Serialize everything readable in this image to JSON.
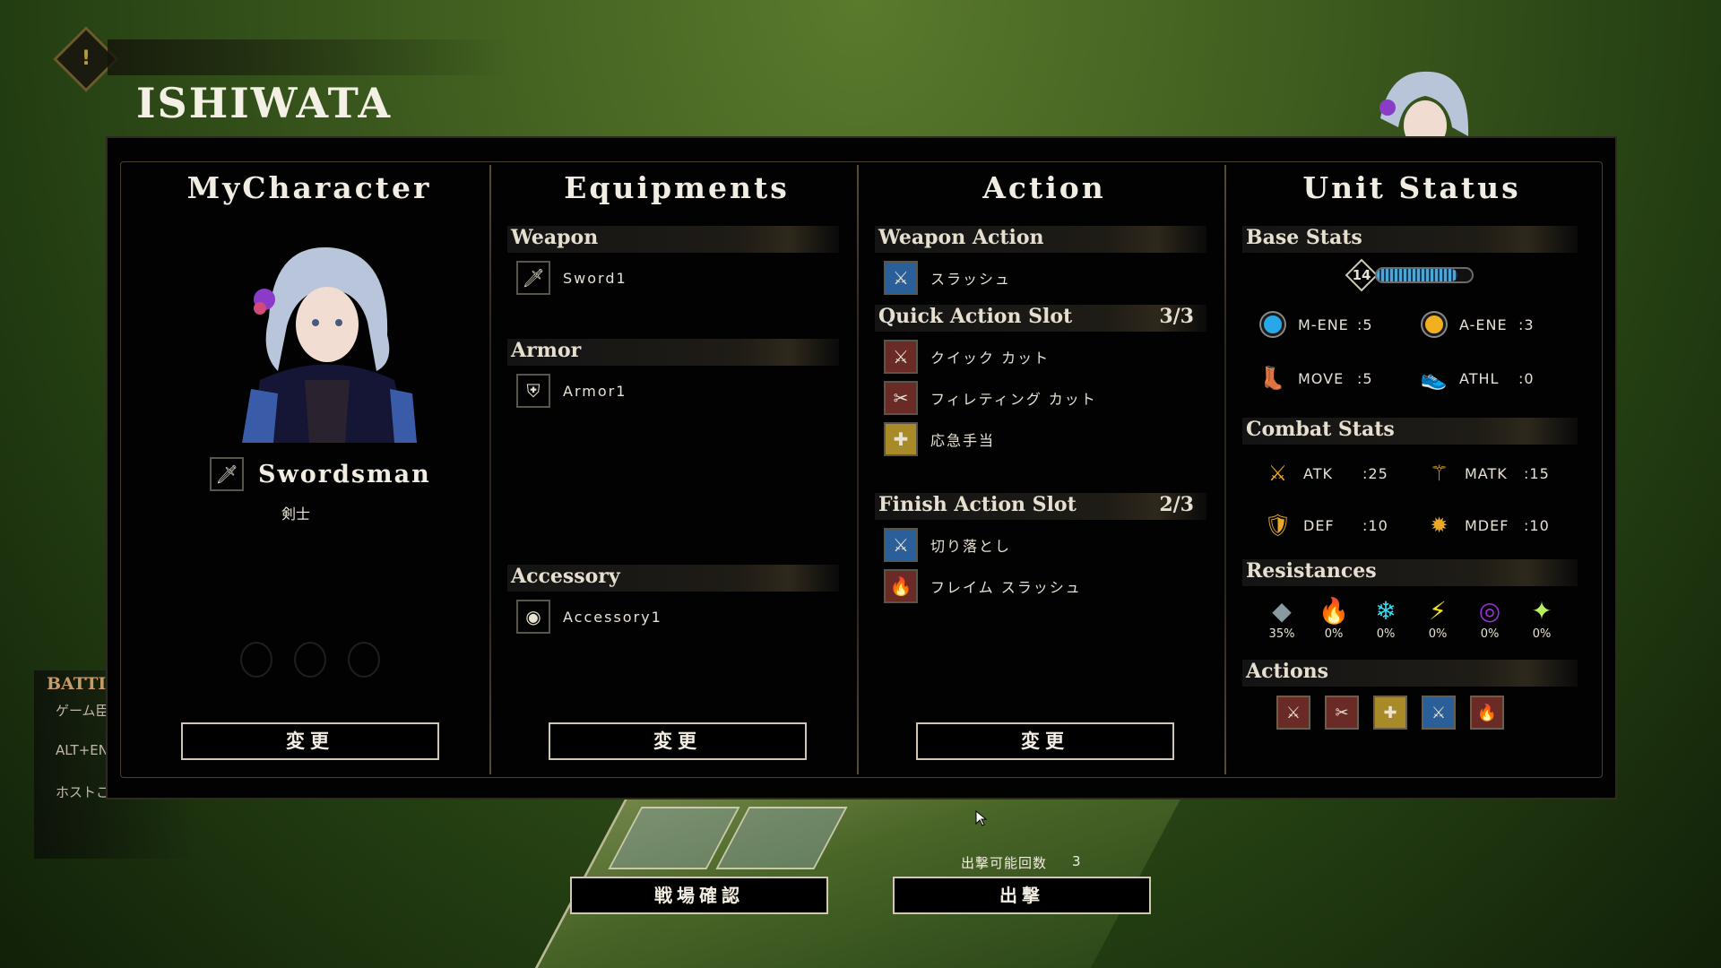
{
  "character": {
    "name": "ISHIWATA",
    "class_name": "Swordsman",
    "class_jp": "剣士"
  },
  "columns": {
    "mycharacter": "MyCharacter",
    "equipments": "Equipments",
    "action": "Action",
    "unit_status": "Unit Status"
  },
  "equipments": {
    "weapon_label": "Weapon",
    "weapon_item": "Sword1",
    "armor_label": "Armor",
    "armor_item": "Armor1",
    "accessory_label": "Accessory",
    "accessory_item": "Accessory1"
  },
  "action": {
    "weapon_action_label": "Weapon Action",
    "weapon_action": "スラッシュ",
    "quick_label": "Quick Action Slot",
    "quick_count": "3/3",
    "quick_items": [
      "クイック カット",
      "フィレティング カット",
      "応急手当"
    ],
    "finish_label": "Finish Action Slot",
    "finish_count": "2/3",
    "finish_items": [
      "切り落とし",
      "フレイム スラッシュ"
    ]
  },
  "status": {
    "base_label": "Base Stats",
    "level": "14",
    "level_fill": 0.85,
    "m_ene_label": "M-ENE",
    "m_ene": ":5",
    "a_ene_label": "A-ENE",
    "a_ene": ":3",
    "move_label": "MOVE",
    "move": ":5",
    "athl_label": "ATHL",
    "athl": ":0",
    "combat_label": "Combat Stats",
    "atk_label": "ATK",
    "atk": ":25",
    "matk_label": "MATK",
    "matk": ":15",
    "def_label": "DEF",
    "def": ":10",
    "mdef_label": "MDEF",
    "mdef": ":10",
    "res_label": "Resistances",
    "resistances": [
      "35%",
      "0%",
      "0%",
      "0%",
      "0%",
      "0%"
    ],
    "actions_label": "Actions"
  },
  "buttons": {
    "change": "変更",
    "battlefield": "戦場確認",
    "sortie": "出撃"
  },
  "sortie_info": {
    "label": "出撃可能回数",
    "count": "3"
  },
  "side_menu": {
    "title": "BATTI",
    "items": [
      "ゲーム臣",
      "ALT+EN",
      "ホストこ"
    ]
  },
  "top_badge": "!",
  "colors": {
    "accent_gold": "#b89a3c",
    "panel_bg": "#020202",
    "m_ene": "#28a8e8",
    "a_ene": "#f0b020"
  }
}
